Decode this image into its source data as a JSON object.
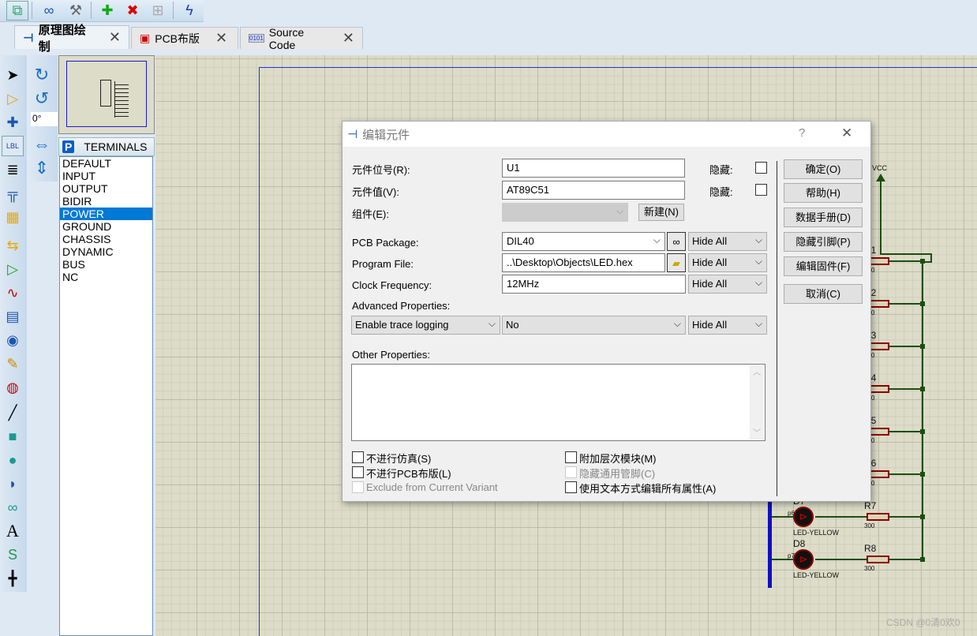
{
  "toolbar": {
    "icons": [
      "design-explorer-icon",
      "binoculars-icon",
      "property-tool-icon",
      "new-sheet-icon",
      "remove-sheet-icon",
      "hierarchy-icon",
      "compile-icon"
    ]
  },
  "tabs": [
    {
      "label": "原理图绘制",
      "icon": "schematic-icon",
      "active": true
    },
    {
      "label": "PCB布版",
      "icon": "chip-icon"
    },
    {
      "label": "Source Code",
      "icon": "source-code-icon"
    }
  ],
  "rotation": {
    "value": "0°"
  },
  "terminals": {
    "header": "TERMINALS",
    "badge": "P",
    "items": [
      "DEFAULT",
      "INPUT",
      "OUTPUT",
      "BIDIR",
      "POWER",
      "GROUND",
      "CHASSIS",
      "DYNAMIC",
      "BUS",
      "NC"
    ],
    "selected": "POWER"
  },
  "dialog": {
    "title": "编辑元件",
    "help": "?",
    "close": "✕",
    "ref_label": "元件位号(R):",
    "ref_value": "U1",
    "hidden_label": "隐藏:",
    "value_label": "元件值(V):",
    "value_value": "AT89C51",
    "group_label": "组件(E):",
    "new_button": "新建(N)",
    "pcb_label": "PCB Package:",
    "pcb_value": "DIL40",
    "prog_label": "Program File:",
    "prog_value": "..\\Desktop\\Objects\\LED.hex",
    "clock_label": "Clock Frequency:",
    "clock_value": "12MHz",
    "hide_all": "Hide All",
    "adv_label": "Advanced Properties:",
    "adv_prop": "Enable trace logging",
    "adv_value": "No",
    "other_label": "Other Properties:",
    "checks": {
      "no_sim": "不进行仿真(S)",
      "no_pcb": "不进行PCB布版(L)",
      "exclude": "Exclude from Current Variant",
      "attach": "附加层次模块(M)",
      "hide_pins": "隐藏通用管脚(C)",
      "edit_text": "使用文本方式编辑所有属性(A)"
    },
    "buttons": [
      "确定(O)",
      "帮助(H)",
      "数据手册(D)",
      "隐藏引脚(P)",
      "编辑固件(F)",
      "取消(C)"
    ]
  },
  "schematic": {
    "vcc": "VCC",
    "resistors": [
      "R1",
      "R2",
      "R3",
      "R4",
      "R5",
      "R6",
      "R7",
      "R8"
    ],
    "res_value": "300",
    "leds": [
      {
        "ref": "D7",
        "pin": "p6",
        "type": "LED-YELLOW"
      },
      {
        "ref": "D8",
        "pin": "p7",
        "type": "LED-YELLOW"
      }
    ]
  },
  "watermark": "CSDN @0清0欢0"
}
